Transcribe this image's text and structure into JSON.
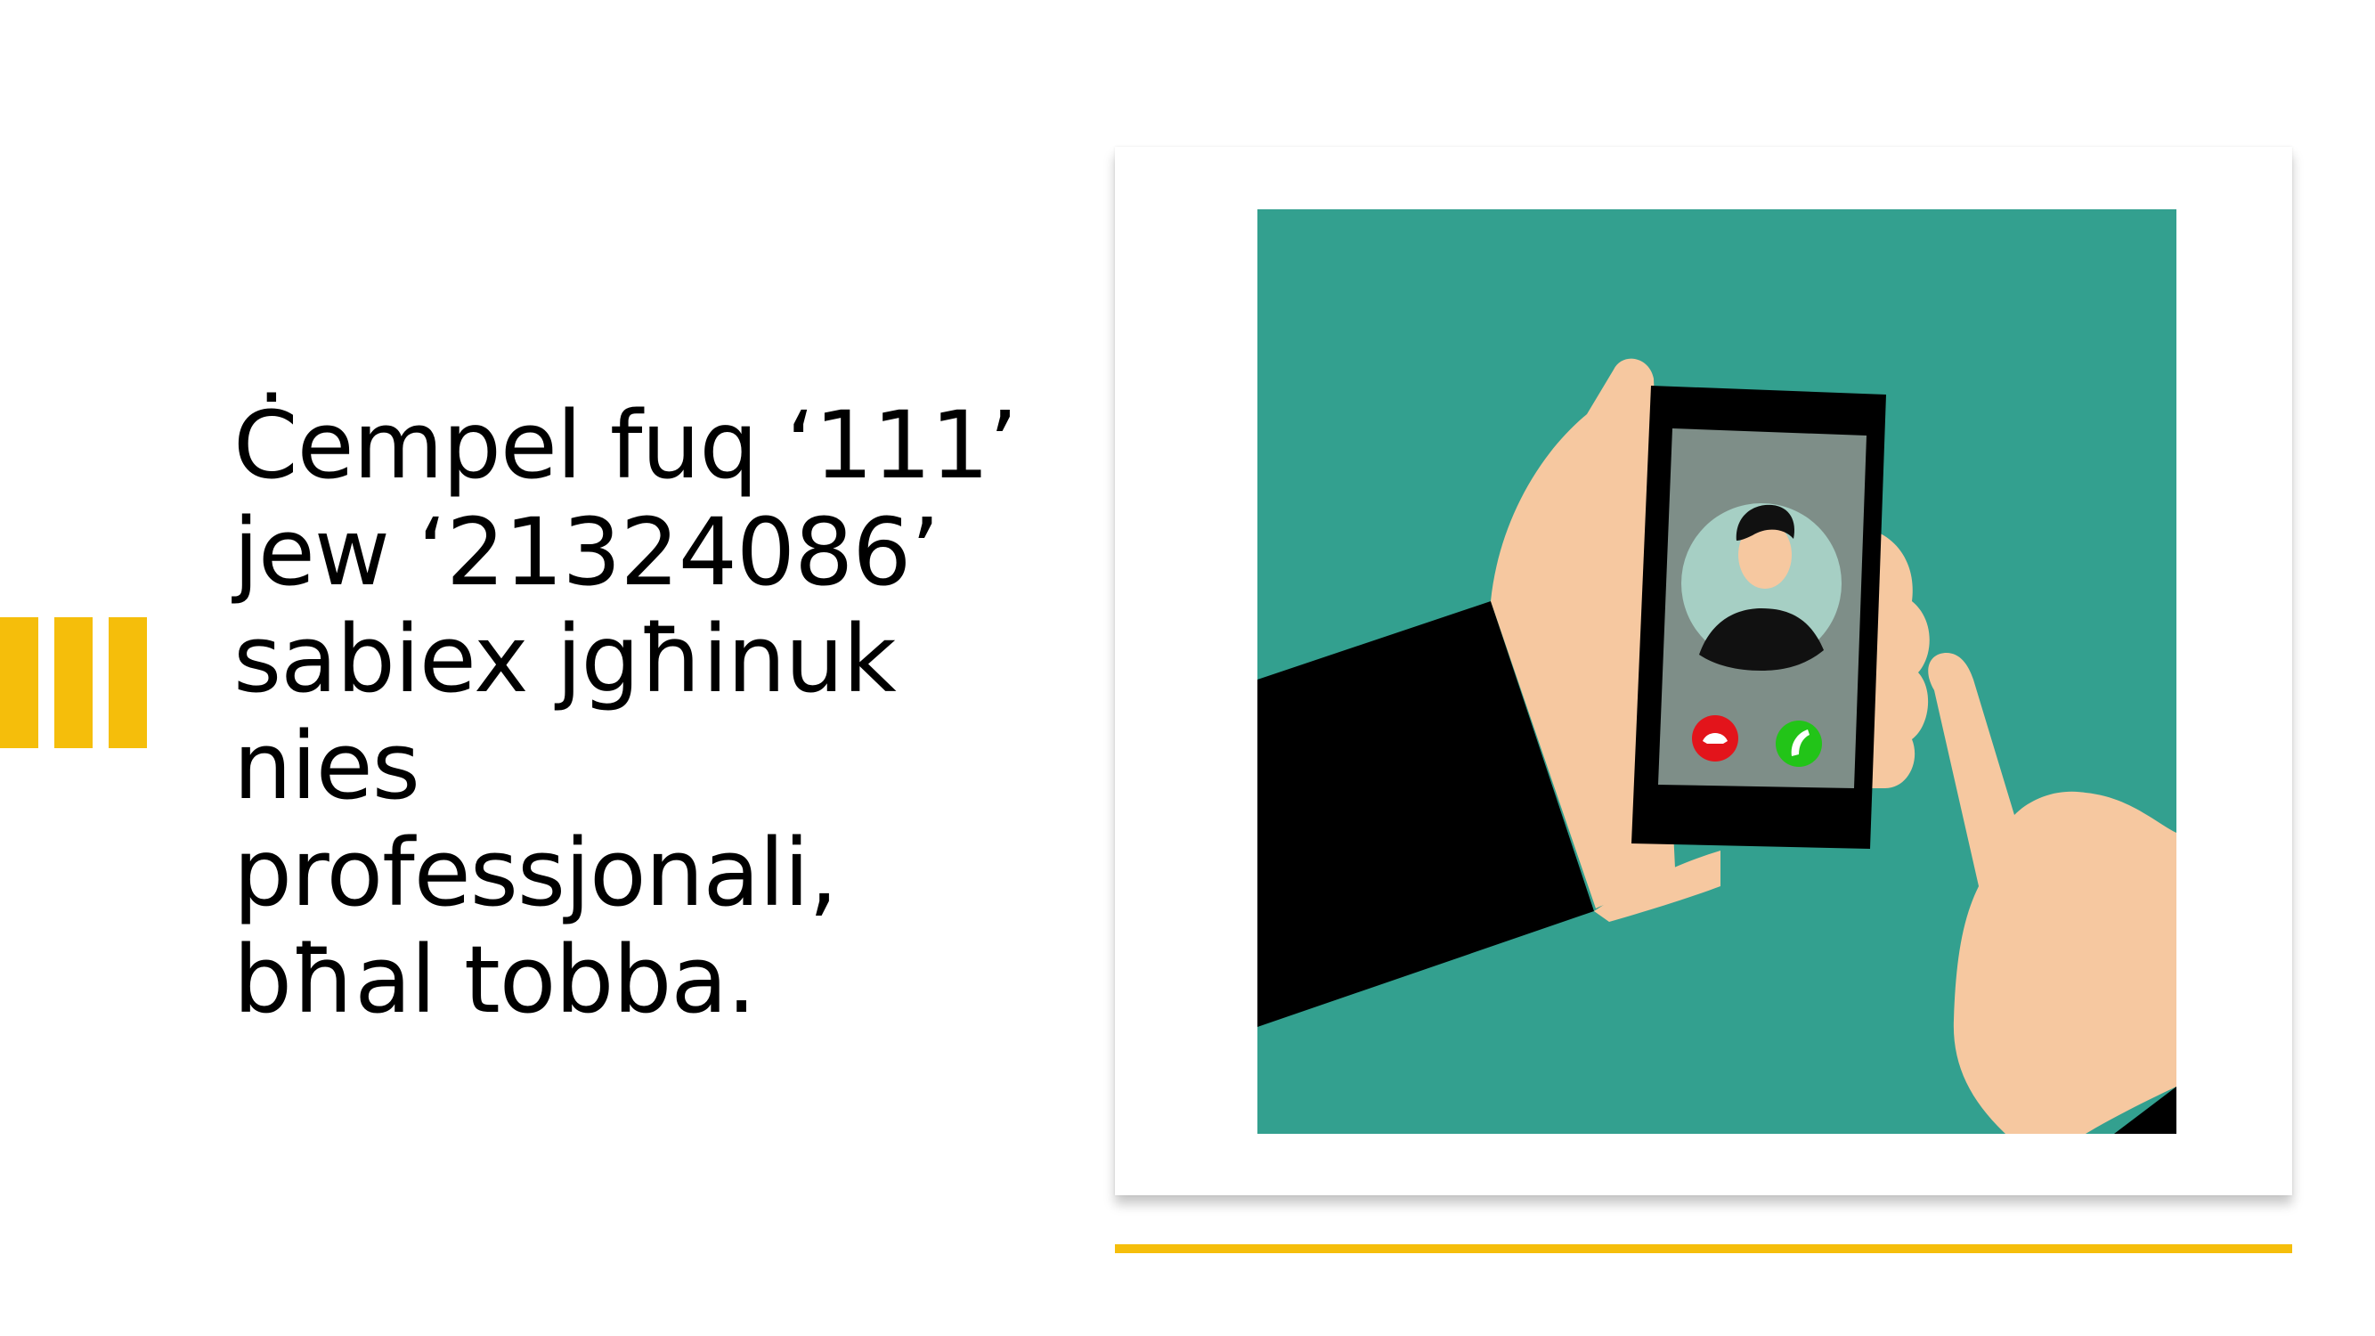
{
  "slide": {
    "accent_color": "#F5BE0B",
    "body_text": "Ċempel fuq ‘111’\njew ‘21324086’\nsabiex jgħinuk\nnies\nprofessjonali,\nbħal tobba.",
    "illustration": {
      "background_color": "#33A08F",
      "skin_color": "#F6C8A0",
      "sleeve_color": "#000000",
      "screen_color": "#7E8E88",
      "decline_color": "#E3141B",
      "accept_color": "#22C418",
      "icons": [
        "phone-hand-icon",
        "caller-avatar-icon",
        "decline-call-icon",
        "accept-call-icon",
        "pointing-finger-icon"
      ]
    }
  }
}
